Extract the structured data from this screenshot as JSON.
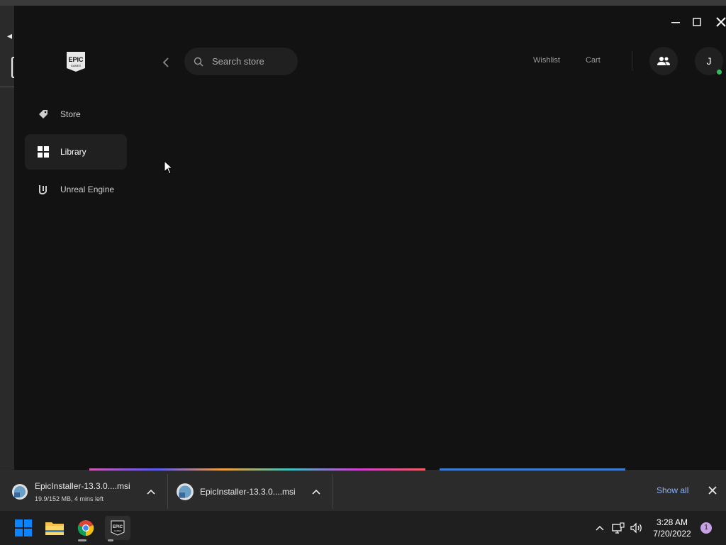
{
  "launcher": {
    "nav": [
      {
        "label": "Store",
        "icon": "tag-icon"
      },
      {
        "label": "Library",
        "icon": "grid-icon"
      },
      {
        "label": "Unreal Engine",
        "icon": "unreal-icon"
      }
    ],
    "active_nav": "Library",
    "search": {
      "placeholder": "Search store"
    },
    "top_links": {
      "wishlist": "Wishlist",
      "cart": "Cart"
    },
    "avatar_initial": "J",
    "logo_text": "EPIC GAMES"
  },
  "downloads": {
    "items": [
      {
        "name": "EpicInstaller-13.3.0....msi",
        "status": "19.9/152 MB, 4 mins left"
      },
      {
        "name": "EpicInstaller-13.3.0....msi",
        "status": ""
      }
    ],
    "show_all": "Show all"
  },
  "taskbar": {
    "apps": [
      "windows-start",
      "file-explorer",
      "google-chrome",
      "epic-games-launcher"
    ],
    "time": "3:28 AM",
    "date": "7/20/2022",
    "notification_count": "1"
  },
  "colors": {
    "launcher_bg": "#121212",
    "nav_active_bg": "#202020",
    "online": "#31c15a",
    "link_blue": "#8ab4f8",
    "windows_blue": "#0a84ff"
  }
}
